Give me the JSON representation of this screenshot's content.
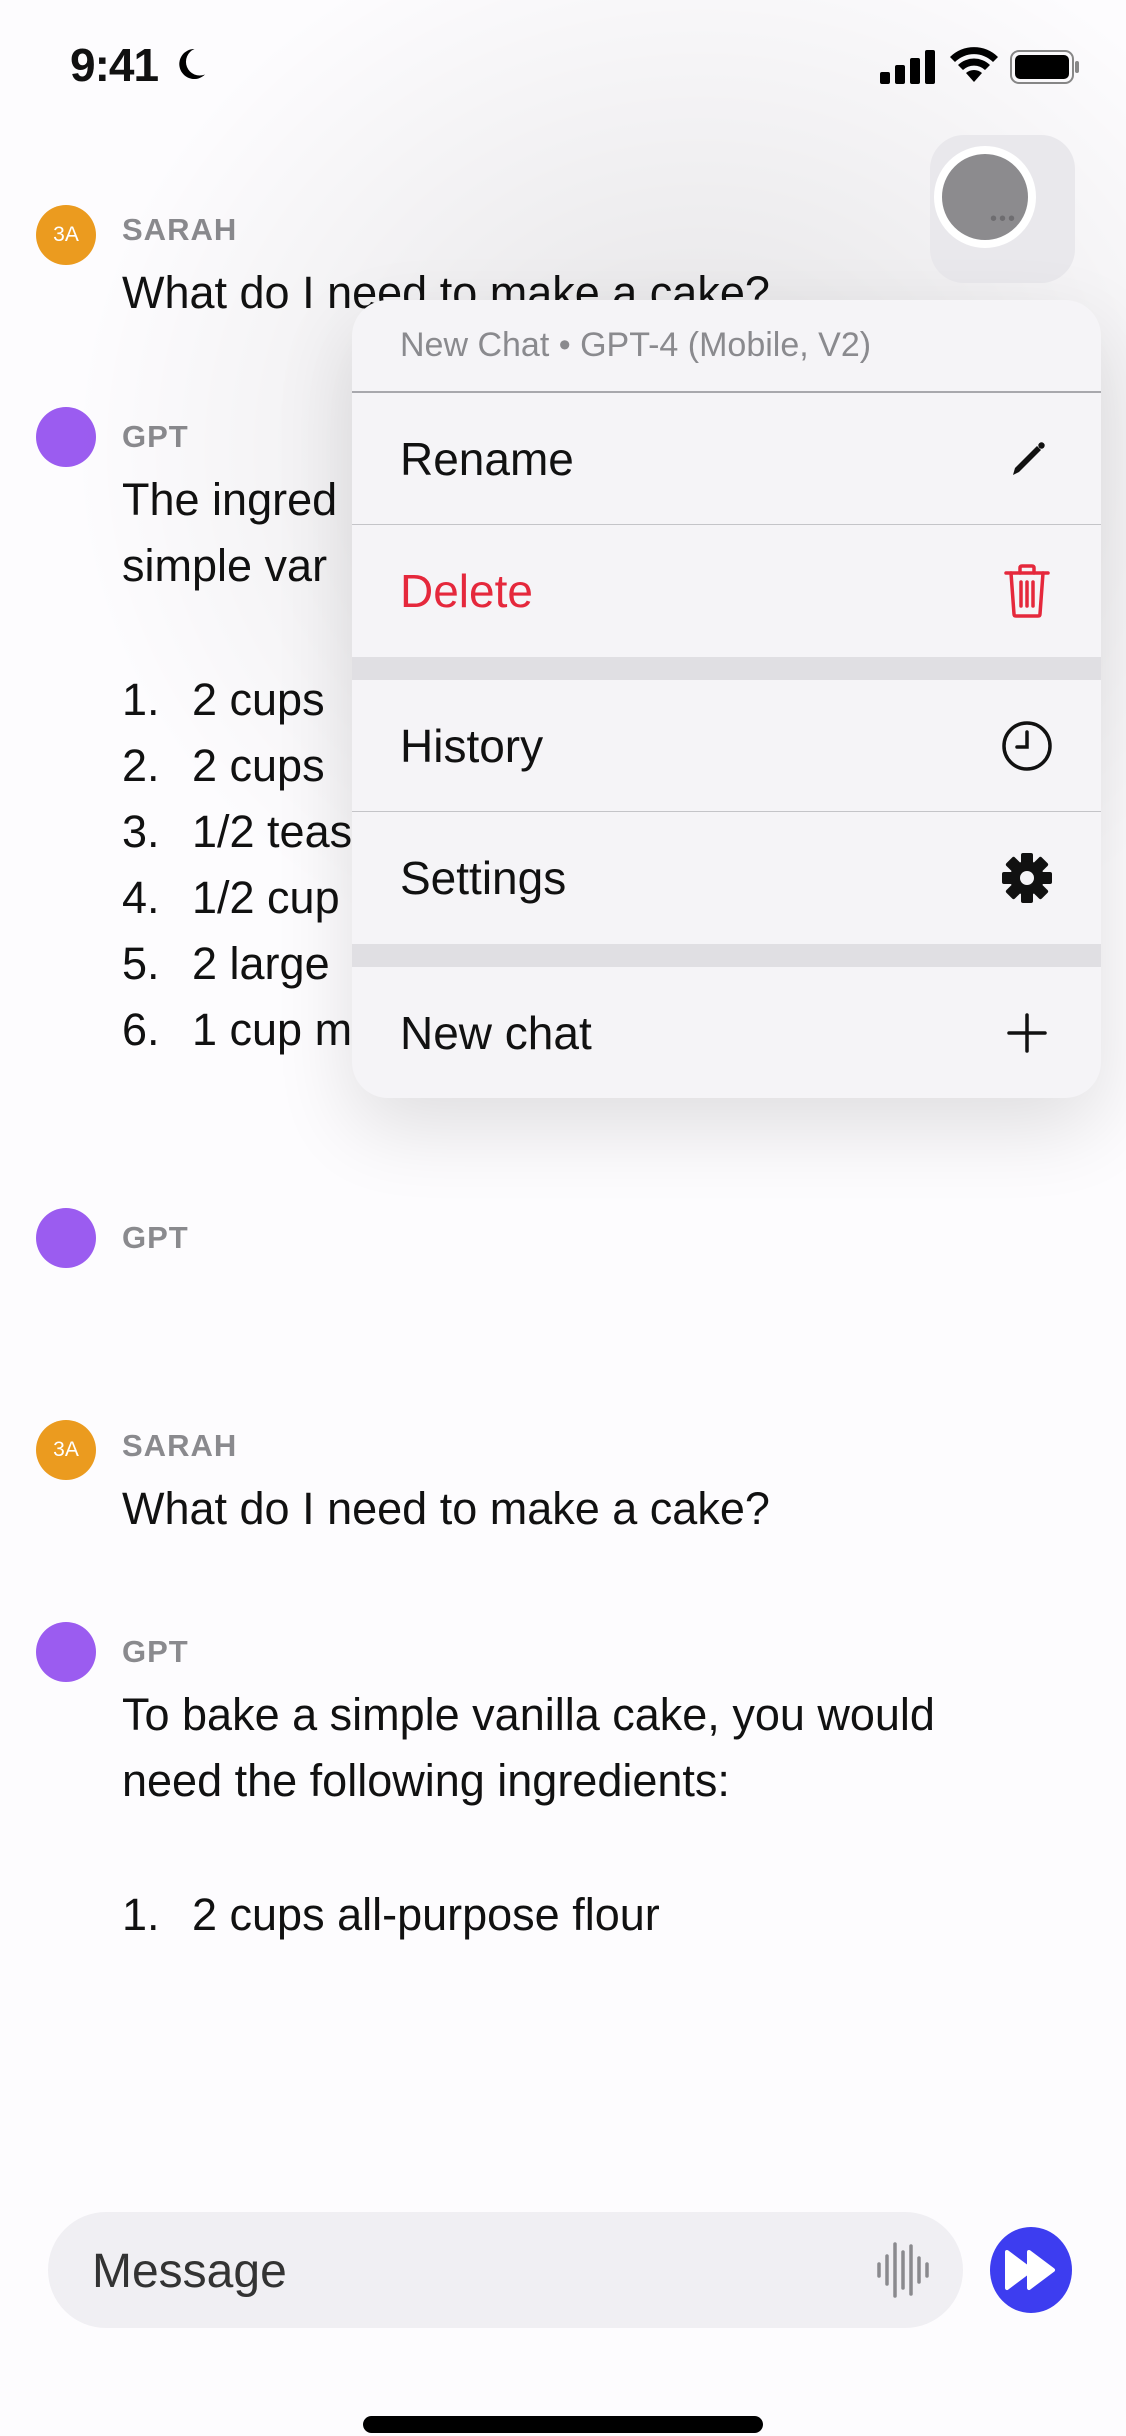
{
  "status_bar": {
    "time": "9:41",
    "focus_icon": "moon-icon",
    "signal_icon": "cellular-signal-icon",
    "wifi_icon": "wifi-icon",
    "battery_icon": "battery-icon"
  },
  "more_button": {
    "icon": "ellipsis-icon",
    "label": "•••"
  },
  "conversation": [
    {
      "role": "user",
      "avatar_text": "3A",
      "name": "SARAH",
      "text": "What do I need to make a cake?"
    },
    {
      "role": "assistant",
      "name": "GPT",
      "text_lines": [
        "The ingred",
        "simple var"
      ],
      "list": [
        {
          "num": "1.",
          "text": "2 cups"
        },
        {
          "num": "2.",
          "text": "2 cups"
        },
        {
          "num": "3.",
          "text": "1/2 teas"
        },
        {
          "num": "4.",
          "text": "1/2 cup"
        },
        {
          "num": "5.",
          "text": "2 large"
        },
        {
          "num": "6.",
          "text": "1 cup m"
        }
      ]
    },
    {
      "role": "assistant",
      "name": "GPT",
      "text": ""
    },
    {
      "role": "user",
      "avatar_text": "3A",
      "name": "SARAH",
      "text": "What do I need to make a cake?"
    },
    {
      "role": "assistant",
      "name": "GPT",
      "text_lines": [
        "To bake a simple vanilla cake, you would",
        "need the following ingredients:"
      ],
      "list": [
        {
          "num": "1.",
          "text": "2 cups all-purpose flour"
        }
      ]
    }
  ],
  "menu": {
    "header": "New Chat • GPT-4 (Mobile, V2)",
    "items": [
      {
        "label": "Rename",
        "icon": "pencil-icon"
      },
      {
        "label": "Delete",
        "icon": "trash-icon",
        "destructive": true
      },
      {
        "label": "History",
        "icon": "clock-icon"
      },
      {
        "label": "Settings",
        "icon": "gear-icon"
      },
      {
        "label": "New chat",
        "icon": "plus-icon"
      }
    ]
  },
  "composer": {
    "placeholder": "Message",
    "value": "",
    "voice_icon": "waveform-icon",
    "send_icon": "fast-forward-icon"
  },
  "colors": {
    "gpt_avatar": "#9b5cf0",
    "user_avatar": "#eb9b1f",
    "destructive": "#e5283c",
    "send_button": "#3d3df0"
  }
}
